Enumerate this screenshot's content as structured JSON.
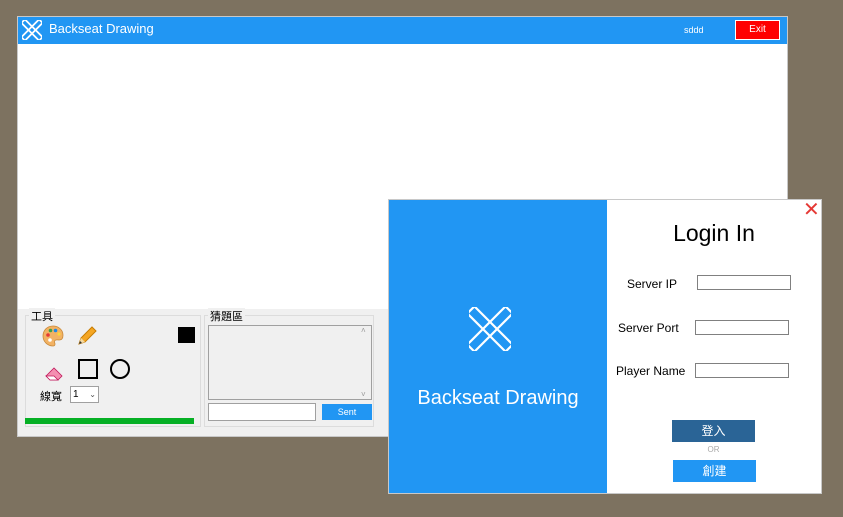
{
  "main_window": {
    "title": "Backseat Drawing",
    "username": "sddd",
    "exit_label": "Exit"
  },
  "tools": {
    "group_title": "工具",
    "items": [
      "palette-icon",
      "pencil-icon",
      "eraser-icon",
      "square-icon",
      "circle-icon"
    ],
    "current_color": "#000000",
    "width_label": "線寬",
    "width_value": "1",
    "progress_percent": 100
  },
  "guess": {
    "group_title": "猜題區",
    "input_value": "",
    "send_label": "Sent"
  },
  "login": {
    "brand": "Backseat Drawing",
    "title": "Login In",
    "close_label": "✕",
    "fields": [
      {
        "label": "Server IP",
        "value": ""
      },
      {
        "label": "Server Port",
        "value": ""
      },
      {
        "label": "Player Name",
        "value": ""
      }
    ],
    "login_label": "登入",
    "or_label": "OR",
    "create_label": "創建"
  },
  "colors": {
    "accent": "#2196f3",
    "exit": "#ff0000",
    "login_button": "#2a6496",
    "progress": "#06b025",
    "close": "#e53935"
  }
}
